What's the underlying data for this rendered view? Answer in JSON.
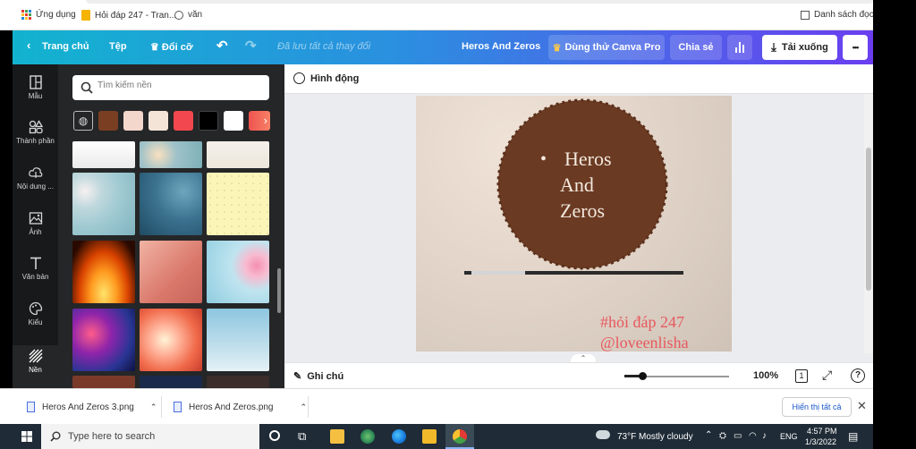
{
  "bookmarks": {
    "apps_label": "Ứng dụng",
    "item1": "Hỏi đáp 247 - Tran...",
    "item2": "văn",
    "reading_list": "Danh sách đọc"
  },
  "toolbar": {
    "home": "Trang chủ",
    "file": "Tệp",
    "resize": "Đổi cỡ",
    "saved_status": "Đã lưu tất cả thay đổi",
    "doc_title": "Heros And Zeros",
    "try_pro": "Dùng thử Canva Pro",
    "share": "Chia sẻ",
    "download": "Tải xuống",
    "more": "•••"
  },
  "rail": {
    "items": [
      {
        "label": "Mẫu",
        "icon": "template-icon"
      },
      {
        "label": "Thành phần",
        "icon": "elements-icon"
      },
      {
        "label": "Nội dung ...",
        "icon": "upload-icon"
      },
      {
        "label": "Ảnh",
        "icon": "photo-icon"
      },
      {
        "label": "Văn bản",
        "icon": "text-icon"
      },
      {
        "label": "Kiểu",
        "icon": "style-icon"
      },
      {
        "label": "Nền",
        "icon": "background-icon"
      }
    ]
  },
  "panel": {
    "search_placeholder": "Tìm kiếm nền",
    "swatches": [
      "#7a3e22",
      "#f3d6cc",
      "#f4e4d8",
      "#f2474e",
      "#000000",
      "#ffffff",
      "#ef5350"
    ]
  },
  "editor": {
    "animate": "Hình động",
    "notes": "Ghi chú",
    "zoom": "100%",
    "page_count": "1",
    "help": "?"
  },
  "design": {
    "bullet": "•",
    "line1": "Heros",
    "line2": "And",
    "line3": "Zeros",
    "watermark1": "#hỏi đáp 247",
    "watermark2": "@loveenlisha",
    "circle_color": "#6b3a22",
    "watermark_color": "#e8585e"
  },
  "downloads": {
    "file1": "Heros And Zeros 3.png",
    "file2": "Heros And Zeros.png",
    "show_all": "Hiển thị tất cả"
  },
  "taskbar": {
    "search": "Type here to search",
    "weather": "73°F  Mostly cloudy",
    "lang": "ENG",
    "time": "4:57 PM",
    "date": "1/3/2022"
  }
}
